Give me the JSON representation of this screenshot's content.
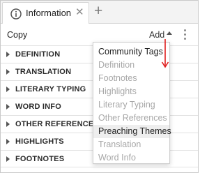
{
  "tab": {
    "label": "Information",
    "icon": "info-circle-icon",
    "close_symbol": "✕",
    "add_symbol": "+"
  },
  "toolbar": {
    "copy_label": "Copy",
    "add_label": "Add"
  },
  "sections": [
    {
      "label": "DEFINITION"
    },
    {
      "label": "TRANSLATION"
    },
    {
      "label": "LITERARY TYPING"
    },
    {
      "label": "WORD INFO"
    },
    {
      "label": "OTHER REFERENCES"
    },
    {
      "label": "HIGHLIGHTS"
    },
    {
      "label": "FOOTNOTES"
    }
  ],
  "add_menu": {
    "items": [
      {
        "label": "Community Tags",
        "enabled": true
      },
      {
        "label": "Definition",
        "enabled": false
      },
      {
        "label": "Footnotes",
        "enabled": false
      },
      {
        "label": "Highlights",
        "enabled": false
      },
      {
        "label": "Literary Typing",
        "enabled": false
      },
      {
        "label": "Other References",
        "enabled": false
      },
      {
        "label": "Preaching Themes",
        "enabled": true,
        "hover": true
      },
      {
        "label": "Translation",
        "enabled": false
      },
      {
        "label": "Word Info",
        "enabled": false
      }
    ]
  },
  "colors": {
    "annotation_arrow": "#e02020",
    "section_text": "#2a2a2a",
    "disabled_text": "#a8a8a8"
  }
}
